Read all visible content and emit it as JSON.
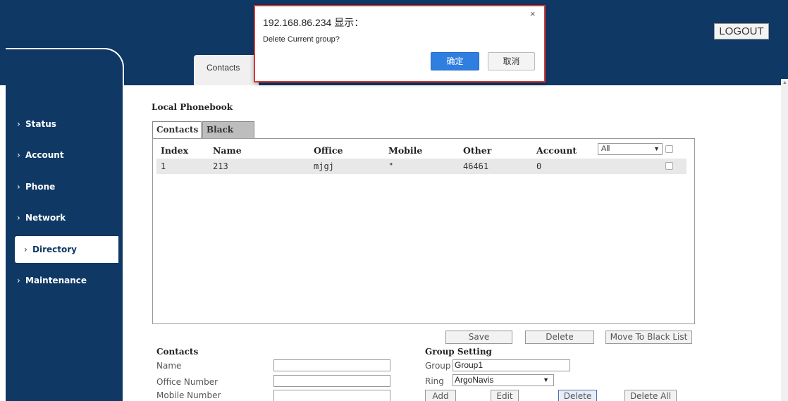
{
  "header": {
    "logout_label": "LOGOUT",
    "top_tab_label": "Contacts"
  },
  "sidebar": {
    "items": [
      {
        "label": "Status"
      },
      {
        "label": "Account"
      },
      {
        "label": "Phone"
      },
      {
        "label": "Network"
      },
      {
        "label": "Directory",
        "active": true
      },
      {
        "label": "Maintenance"
      }
    ],
    "chevron": "›"
  },
  "main": {
    "section_title": "Local Phonebook",
    "tabs": [
      {
        "label": "Contacts"
      },
      {
        "label": "Black List"
      }
    ],
    "table": {
      "columns": [
        "Index",
        "Name",
        "Office",
        "Mobile",
        "Other",
        "Account"
      ],
      "filter_value": "All",
      "rows": [
        {
          "index": "1",
          "name": "213",
          "office": "mjgj",
          "mobile": "\"",
          "other": "46461",
          "account": "0"
        }
      ]
    },
    "list_buttons": {
      "save": "Save",
      "delete": "Delete",
      "move_to_black_list": "Move To Black List"
    }
  },
  "contacts_form": {
    "title": "Contacts",
    "fields": [
      {
        "label": "Name",
        "value": ""
      },
      {
        "label": "Office Number",
        "value": ""
      },
      {
        "label": "Mobile Number",
        "value": ""
      }
    ]
  },
  "group_setting": {
    "title": "Group Setting",
    "group_label": "Group",
    "group_value": "Group1",
    "ring_label": "Ring",
    "ring_value": "ArgoNavis",
    "buttons": {
      "add": "Add",
      "edit": "Edit",
      "delete": "Delete",
      "delete_all": "Delete All"
    }
  },
  "dialog": {
    "title": "192.168.86.234 显示：",
    "message": "Delete Current group?",
    "ok_label": "确定",
    "cancel_label": "取消",
    "close_icon": "×"
  },
  "colors": {
    "nav_bg": "#0f3865",
    "content_bg": "#ffffff",
    "dialog_ok": "#2f7fe0",
    "dialog_border": "#d23a3a"
  }
}
